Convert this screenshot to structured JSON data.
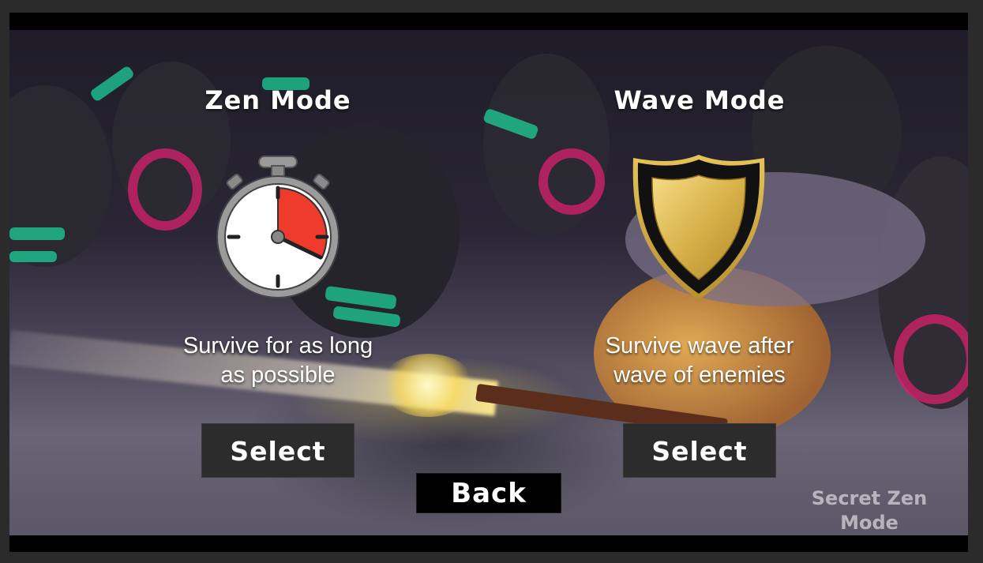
{
  "modes": [
    {
      "title": "Zen Mode",
      "icon": "stopwatch-icon",
      "desc_line1": "Survive for as long",
      "desc_line2": "as possible",
      "button_label": "Select"
    },
    {
      "title": "Wave Mode",
      "icon": "shield-icon",
      "desc_line1": "Survive wave after",
      "desc_line2": "wave of enemies",
      "button_label": "Select"
    }
  ],
  "back_label": "Back",
  "secret": {
    "line1": "Secret Zen",
    "line2": "Mode"
  },
  "colors": {
    "button_bg": "#2c2c2c",
    "stopwatch_fill": "#ef3b2c",
    "shield_gold": "#d9b24a",
    "accent_stripes": "#1ecf9a",
    "accent_rings": "#d0226a"
  }
}
